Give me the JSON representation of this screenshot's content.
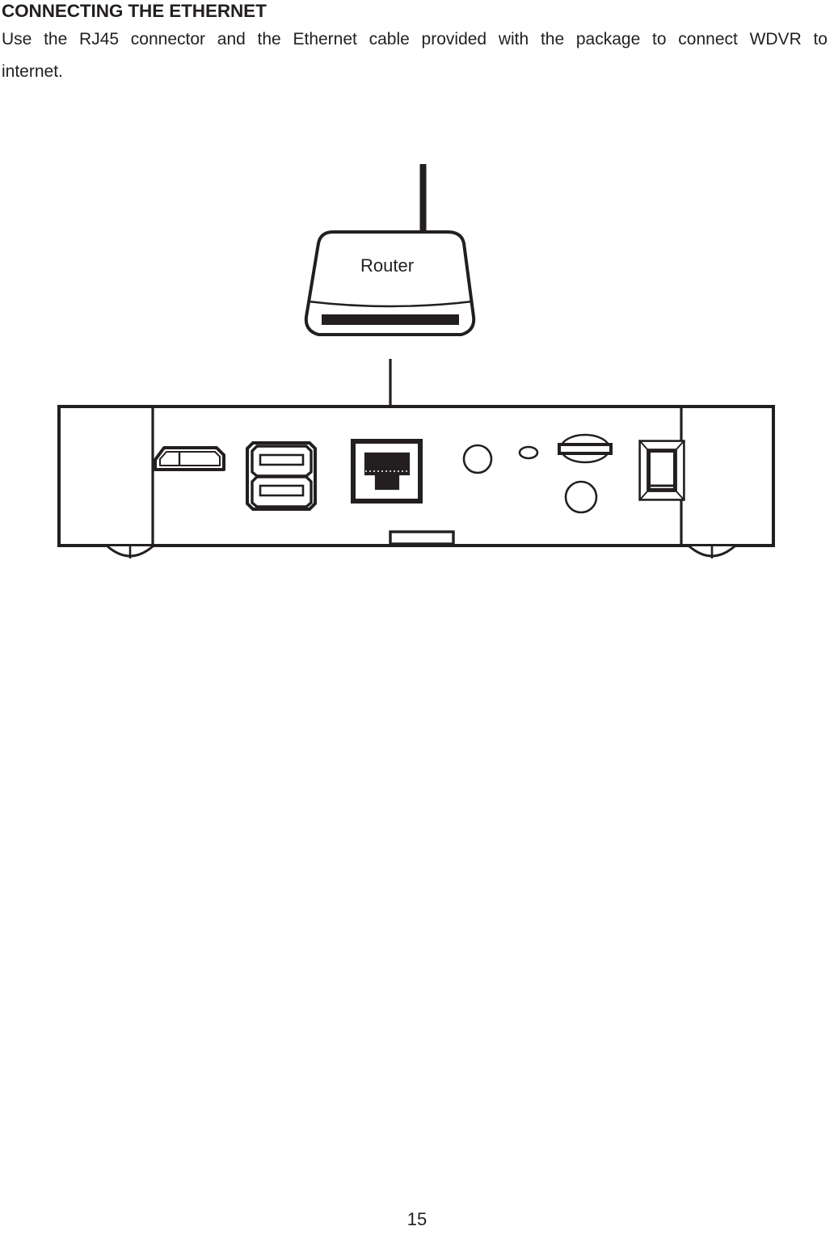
{
  "document": {
    "heading": "CONNECTING THE ETHERNET",
    "paragraph_line1": "Use the RJ45 connector and the Ethernet cable provided with the package to connect WDVR to",
    "paragraph_line2": "internet.",
    "paragraph_full": "Use the RJ45 connector and the Ethernet cable provided with the package to connect WDVR to internet.",
    "page_number": "15"
  },
  "figure": {
    "title": "Ethernet connection diagram",
    "router": {
      "label": "Router",
      "antenna": "antenna",
      "vent_slot": "front-vent-slot"
    },
    "connection": {
      "arrow": "down-arrow",
      "from": "Router",
      "to": "RJ45 ethernet port"
    },
    "device_panel": {
      "name": "WDVR rear panel",
      "ports": [
        {
          "id": "hdmi-port",
          "label": "HDMI"
        },
        {
          "id": "usb-port-upper",
          "label": "USB"
        },
        {
          "id": "usb-port-lower",
          "label": "USB"
        },
        {
          "id": "rj45-port",
          "label": "RJ45"
        },
        {
          "id": "av-jack",
          "label": "AV jack"
        },
        {
          "id": "indicator-oval",
          "label": "indicator"
        },
        {
          "id": "reset-screw",
          "label": "reset"
        },
        {
          "id": "dc-jack",
          "label": "DC power jack"
        },
        {
          "id": "power-switch",
          "label": "Power switch"
        }
      ],
      "feet": [
        "foot-left",
        "foot-right"
      ],
      "bottom_tab": "bottom-tab"
    }
  },
  "colors": {
    "ink": "#231f20",
    "paper": "#ffffff",
    "dark_fill": "#231f20"
  }
}
